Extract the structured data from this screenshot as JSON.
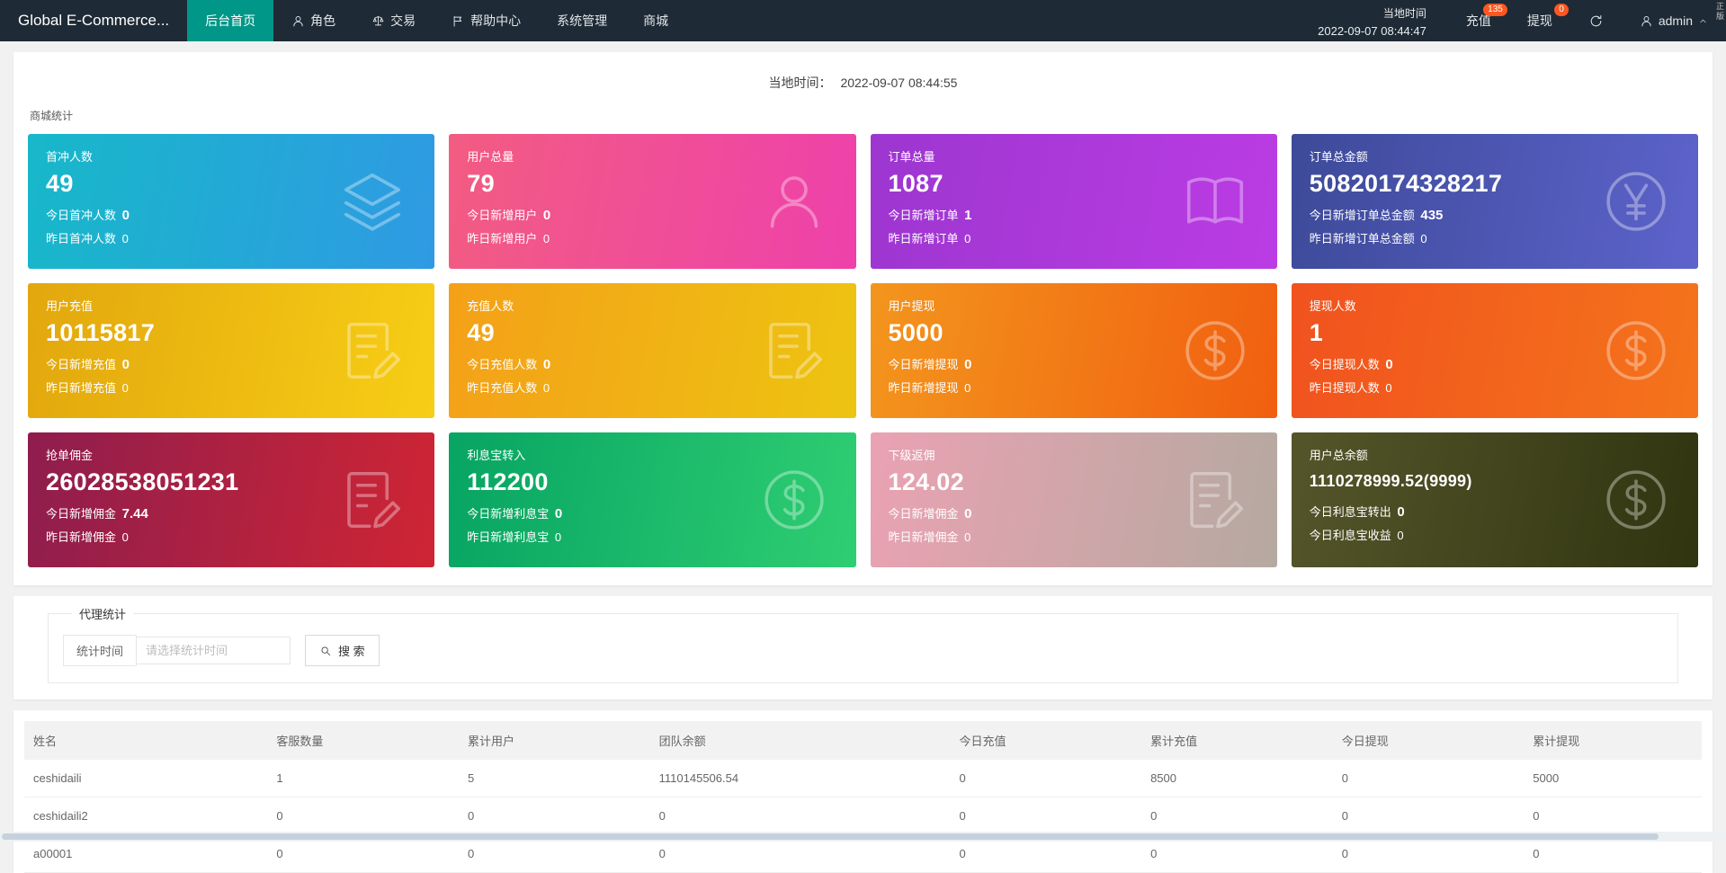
{
  "theme": {
    "navbar_bg": "#1e2a35",
    "active_nav": "#009688",
    "badge": "#ff5722",
    "page_bg": "#f1f1f1",
    "panel_bg": "#ffffff"
  },
  "navbar": {
    "brand": "Global E-Commerce...",
    "items": [
      {
        "label": "后台首页",
        "active": true
      },
      {
        "label": "角色",
        "icon": "user"
      },
      {
        "label": "交易",
        "icon": "scale"
      },
      {
        "label": "帮助中心",
        "icon": "flag"
      },
      {
        "label": "系统管理"
      },
      {
        "label": "商城"
      }
    ],
    "local_time_label": "当地时间",
    "local_time_value": "2022-09-07 08:44:47",
    "recharge": {
      "label": "充值",
      "badge": "135"
    },
    "withdraw": {
      "label": "提现",
      "badge": "0"
    },
    "username": "admin",
    "corner_watermark": "正版"
  },
  "overview": {
    "time_label": "当地时间：",
    "time_value": "2022-09-07 08:44:55",
    "section_title": "商城统计",
    "cards": [
      {
        "title": "首冲人数",
        "value": "49",
        "line1_label": "今日首冲人数",
        "line1_value": "0",
        "line2_label": "昨日首冲人数",
        "line2_value": "0",
        "icon": "layers",
        "gradient": [
          "#17b8c9",
          "#2f9ae3"
        ]
      },
      {
        "title": "用户总量",
        "value": "79",
        "line1_label": "今日新增用户",
        "line1_value": "0",
        "line2_label": "昨日新增用户",
        "line2_value": "0",
        "icon": "user",
        "gradient": [
          "#f25c82",
          "#ee41ab"
        ]
      },
      {
        "title": "订单总量",
        "value": "1087",
        "line1_label": "今日新增订单",
        "line1_value": "1",
        "line2_label": "昨日新增订单",
        "line2_value": "0",
        "icon": "book",
        "gradient": [
          "#9d36d0",
          "#bb3ce4"
        ]
      },
      {
        "title": "订单总金额",
        "value": "50820174328217",
        "line1_label": "今日新增订单总金额",
        "line1_value": "435",
        "line2_label": "昨日新增订单总金额",
        "line2_value": "0",
        "icon": "yen",
        "gradient": [
          "#3d4a99",
          "#5d63cb"
        ]
      },
      {
        "title": "用户充值",
        "value": "10115817",
        "line1_label": "今日新增充值",
        "line1_value": "0",
        "line2_label": "昨日新增充值",
        "line2_value": "0",
        "icon": "doc-edit",
        "gradient": [
          "#e2a70d",
          "#f7ce16"
        ]
      },
      {
        "title": "充值人数",
        "value": "49",
        "line1_label": "今日充值人数",
        "line1_value": "0",
        "line2_label": "昨日充值人数",
        "line2_value": "0",
        "icon": "doc-edit",
        "gradient": [
          "#f4a018",
          "#edc411"
        ]
      },
      {
        "title": "用户提现",
        "value": "5000",
        "line1_label": "今日新增提现",
        "line1_value": "0",
        "line2_label": "昨日新增提现",
        "line2_value": "0",
        "icon": "dollar",
        "gradient": [
          "#f3951d",
          "#f15f10"
        ]
      },
      {
        "title": "提现人数",
        "value": "1",
        "line1_label": "今日提现人数",
        "line1_value": "0",
        "line2_label": "昨日提现人数",
        "line2_value": "0",
        "icon": "dollar",
        "gradient": [
          "#f1521e",
          "#f4741b"
        ]
      },
      {
        "title": "抢单佣金",
        "value": "26028538051231",
        "line1_label": "今日新增佣金",
        "line1_value": "7.44",
        "line2_label": "昨日新增佣金",
        "line2_value": "0",
        "icon": "doc-edit",
        "gradient": [
          "#8e1d4e",
          "#cf2534"
        ]
      },
      {
        "title": "利息宝转入",
        "value": "112200",
        "line1_label": "今日新增利息宝",
        "line1_value": "0",
        "line2_label": "昨日新增利息宝",
        "line2_value": "0",
        "icon": "dollar",
        "gradient": [
          "#07a463",
          "#2fce72"
        ]
      },
      {
        "title": "下级返佣",
        "value": "124.02",
        "line1_label": "今日新增佣金",
        "line1_value": "0",
        "line2_label": "昨日新增佣金",
        "line2_value": "0",
        "icon": "doc-edit",
        "gradient": [
          "#eaa2b2",
          "#b5a9a0"
        ]
      },
      {
        "title": "用户总余额",
        "value": "1110278999.52(9999)",
        "value_size": "small",
        "line1_label": "今日利息宝转出",
        "line1_value": "0",
        "line2_label": "今日利息宝收益",
        "line2_value": "0",
        "icon": "dollar",
        "gradient": [
          "#54552a",
          "#303510"
        ]
      }
    ]
  },
  "agent": {
    "legend": "代理统计",
    "filter_label": "统计时间",
    "input_placeholder": "请选择统计时间",
    "search_label": "搜 索"
  },
  "table": {
    "headers": [
      "姓名",
      "客服数量",
      "累计用户",
      "团队余额",
      "今日充值",
      "累计充值",
      "今日提现",
      "累计提现"
    ],
    "rows": [
      [
        "ceshidaili",
        "1",
        "5",
        "1110145506.54",
        "0",
        "8500",
        "0",
        "5000"
      ],
      [
        "ceshidaili2",
        "0",
        "0",
        "0",
        "0",
        "0",
        "0",
        "0"
      ],
      [
        "a00001",
        "0",
        "0",
        "0",
        "0",
        "0",
        "0",
        "0"
      ]
    ]
  }
}
